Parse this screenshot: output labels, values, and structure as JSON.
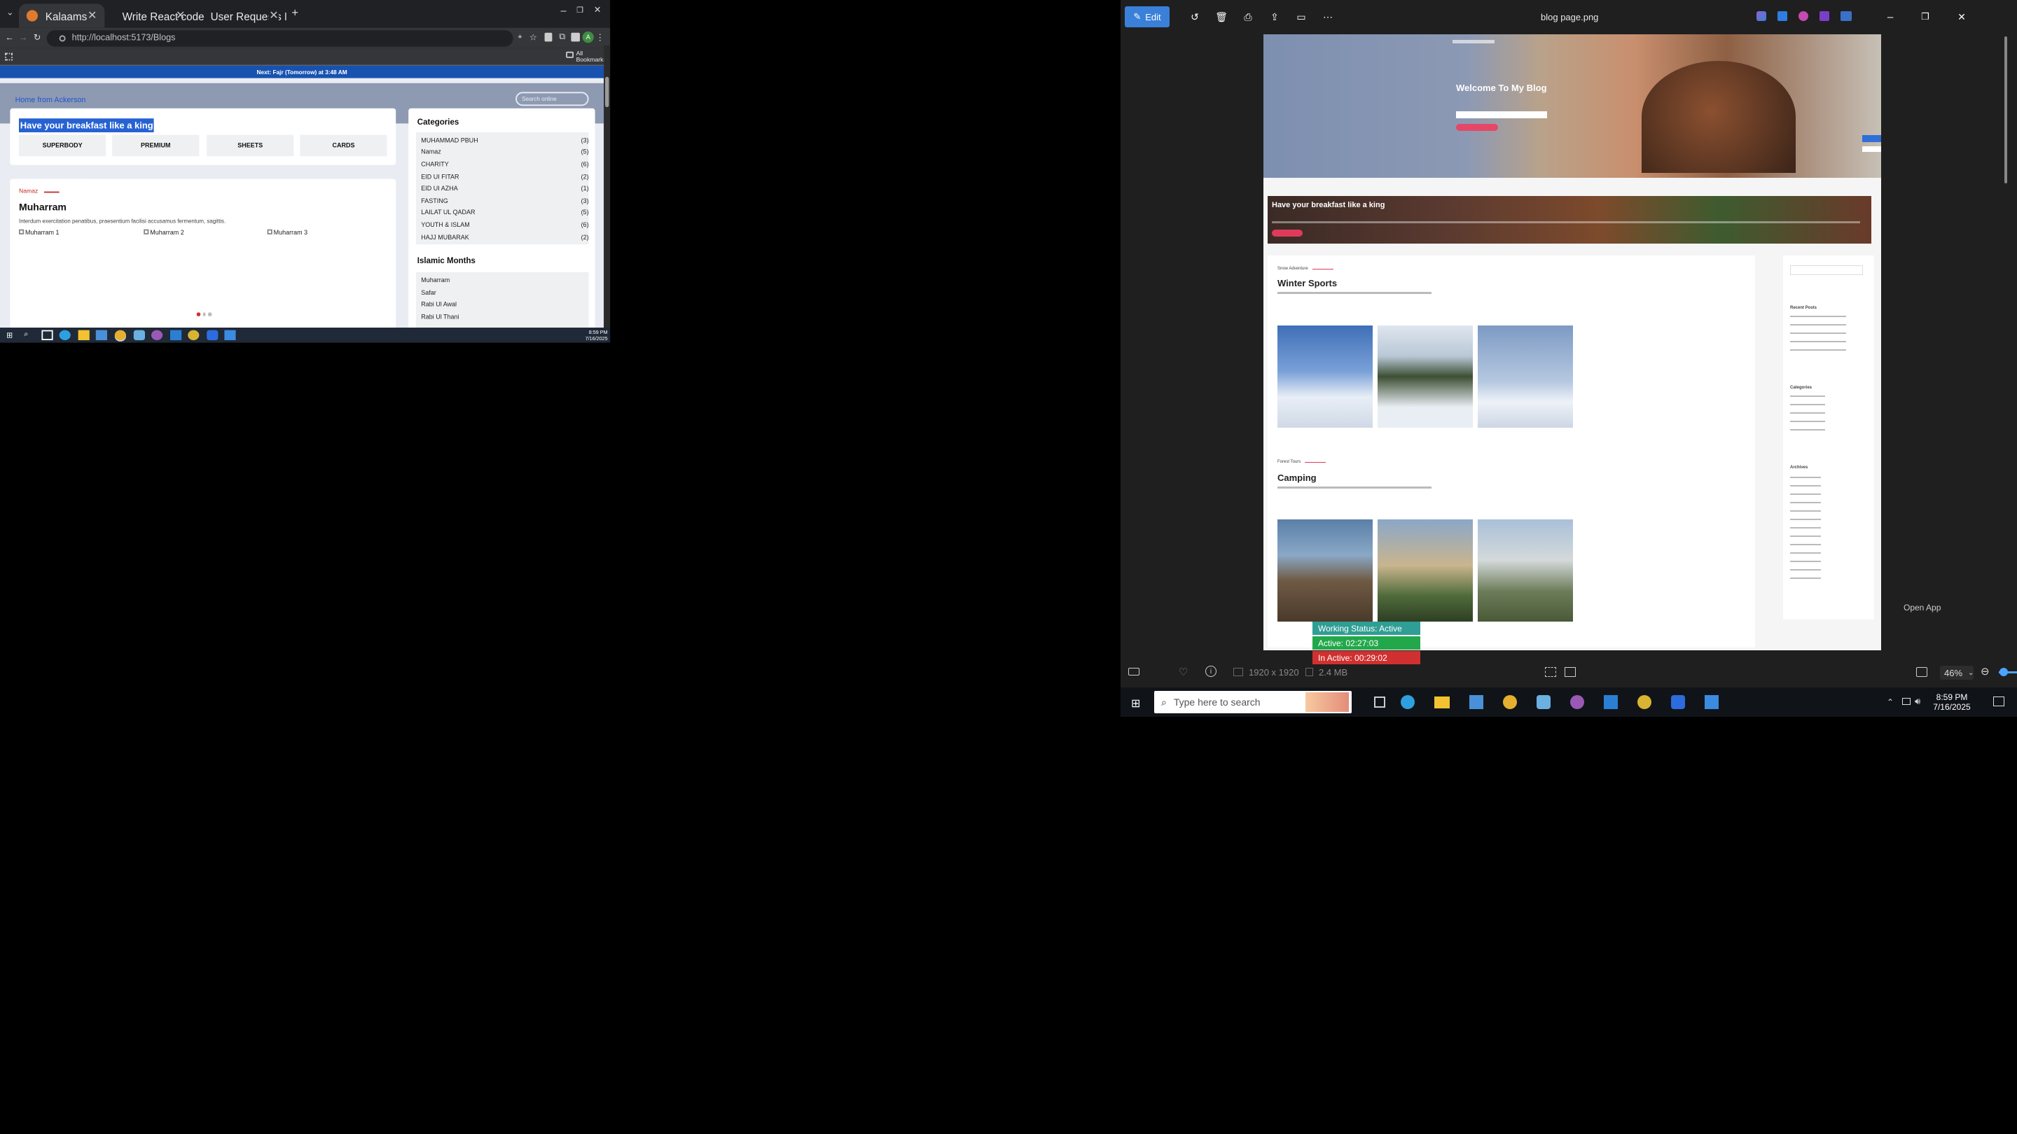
{
  "browser": {
    "tabs": [
      {
        "label": "Kalaams",
        "active": true
      },
      {
        "label": "Write React code",
        "active": false
      },
      {
        "label": "User Requests Listening Assista",
        "active": false
      }
    ],
    "url": "http://localhost:5173/Blogs",
    "all_bookmarks_label": "All Bookmarks",
    "profile_initial": "A"
  },
  "page": {
    "prayer_text": "Next: Fajr (Tomorrow) at 3:48 AM",
    "hero_title": "Home from Ackerson",
    "search_placeholder": "Search online",
    "heading": "Have your breakfast like a king",
    "tag_buttons": [
      "SUPERBODY",
      "PREMIUM",
      "SHEETS",
      "CARDS"
    ],
    "post": {
      "category": "Namaz",
      "title": "Muharram",
      "excerpt": "Interdum exercitation penatibus, praesentium facilisi accusamus fermentum, sagittis.",
      "images": [
        "Muharram 1",
        "Muharram 2",
        "Muharram 3"
      ]
    },
    "categories_title": "Categories",
    "categories": [
      {
        "name": "MUHAMMAD PBUH",
        "count": "(3)"
      },
      {
        "name": "Namaz",
        "count": "(5)"
      },
      {
        "name": "CHARITY",
        "count": "(6)"
      },
      {
        "name": "EID UI FITAR",
        "count": "(2)"
      },
      {
        "name": "EID UI AZHA",
        "count": "(1)"
      },
      {
        "name": "FASTING",
        "count": "(3)"
      },
      {
        "name": "LAILAT UL QADAR",
        "count": "(5)"
      },
      {
        "name": "YOUTH & ISLAM",
        "count": "(6)"
      },
      {
        "name": "HAJJ MUBARAK",
        "count": "(2)"
      }
    ],
    "months_title": "Islamic Months",
    "months": [
      "Muharram",
      "Safar",
      "Rabi Ul Awal",
      "Rabi Ul Thani"
    ]
  },
  "left_clock": {
    "time": "8:59 PM",
    "date": "7/16/2025"
  },
  "viewer": {
    "edit_label": "Edit",
    "filename": "blog page.png",
    "dimensions": "1920 x 1920",
    "filesize": "2.4 MB",
    "zoom": "46%",
    "open_app": "Open App",
    "status": [
      {
        "label": "Working Status: Active",
        "color": "#2f9e94"
      },
      {
        "label": "Active: 02:27:03",
        "color": "#22a84a"
      },
      {
        "label": "In Active: 00:29:02",
        "color": "#d13030"
      }
    ]
  },
  "blog_image": {
    "hero_title": "Welcome To My Blog",
    "banner_title": "Have your breakfast like a king",
    "section1_kicker": "Snow Adventure",
    "section1_title": "Winter Sports",
    "section2_kicker": "Forest Tours",
    "section2_title": "Camping",
    "sidebar_recent": "Recent Posts",
    "sidebar_categories": "Categories",
    "sidebar_archives": "Archives"
  },
  "taskbar": {
    "search_placeholder": "Type here to search",
    "time": "8:59 PM",
    "date": "7/16/2025"
  }
}
